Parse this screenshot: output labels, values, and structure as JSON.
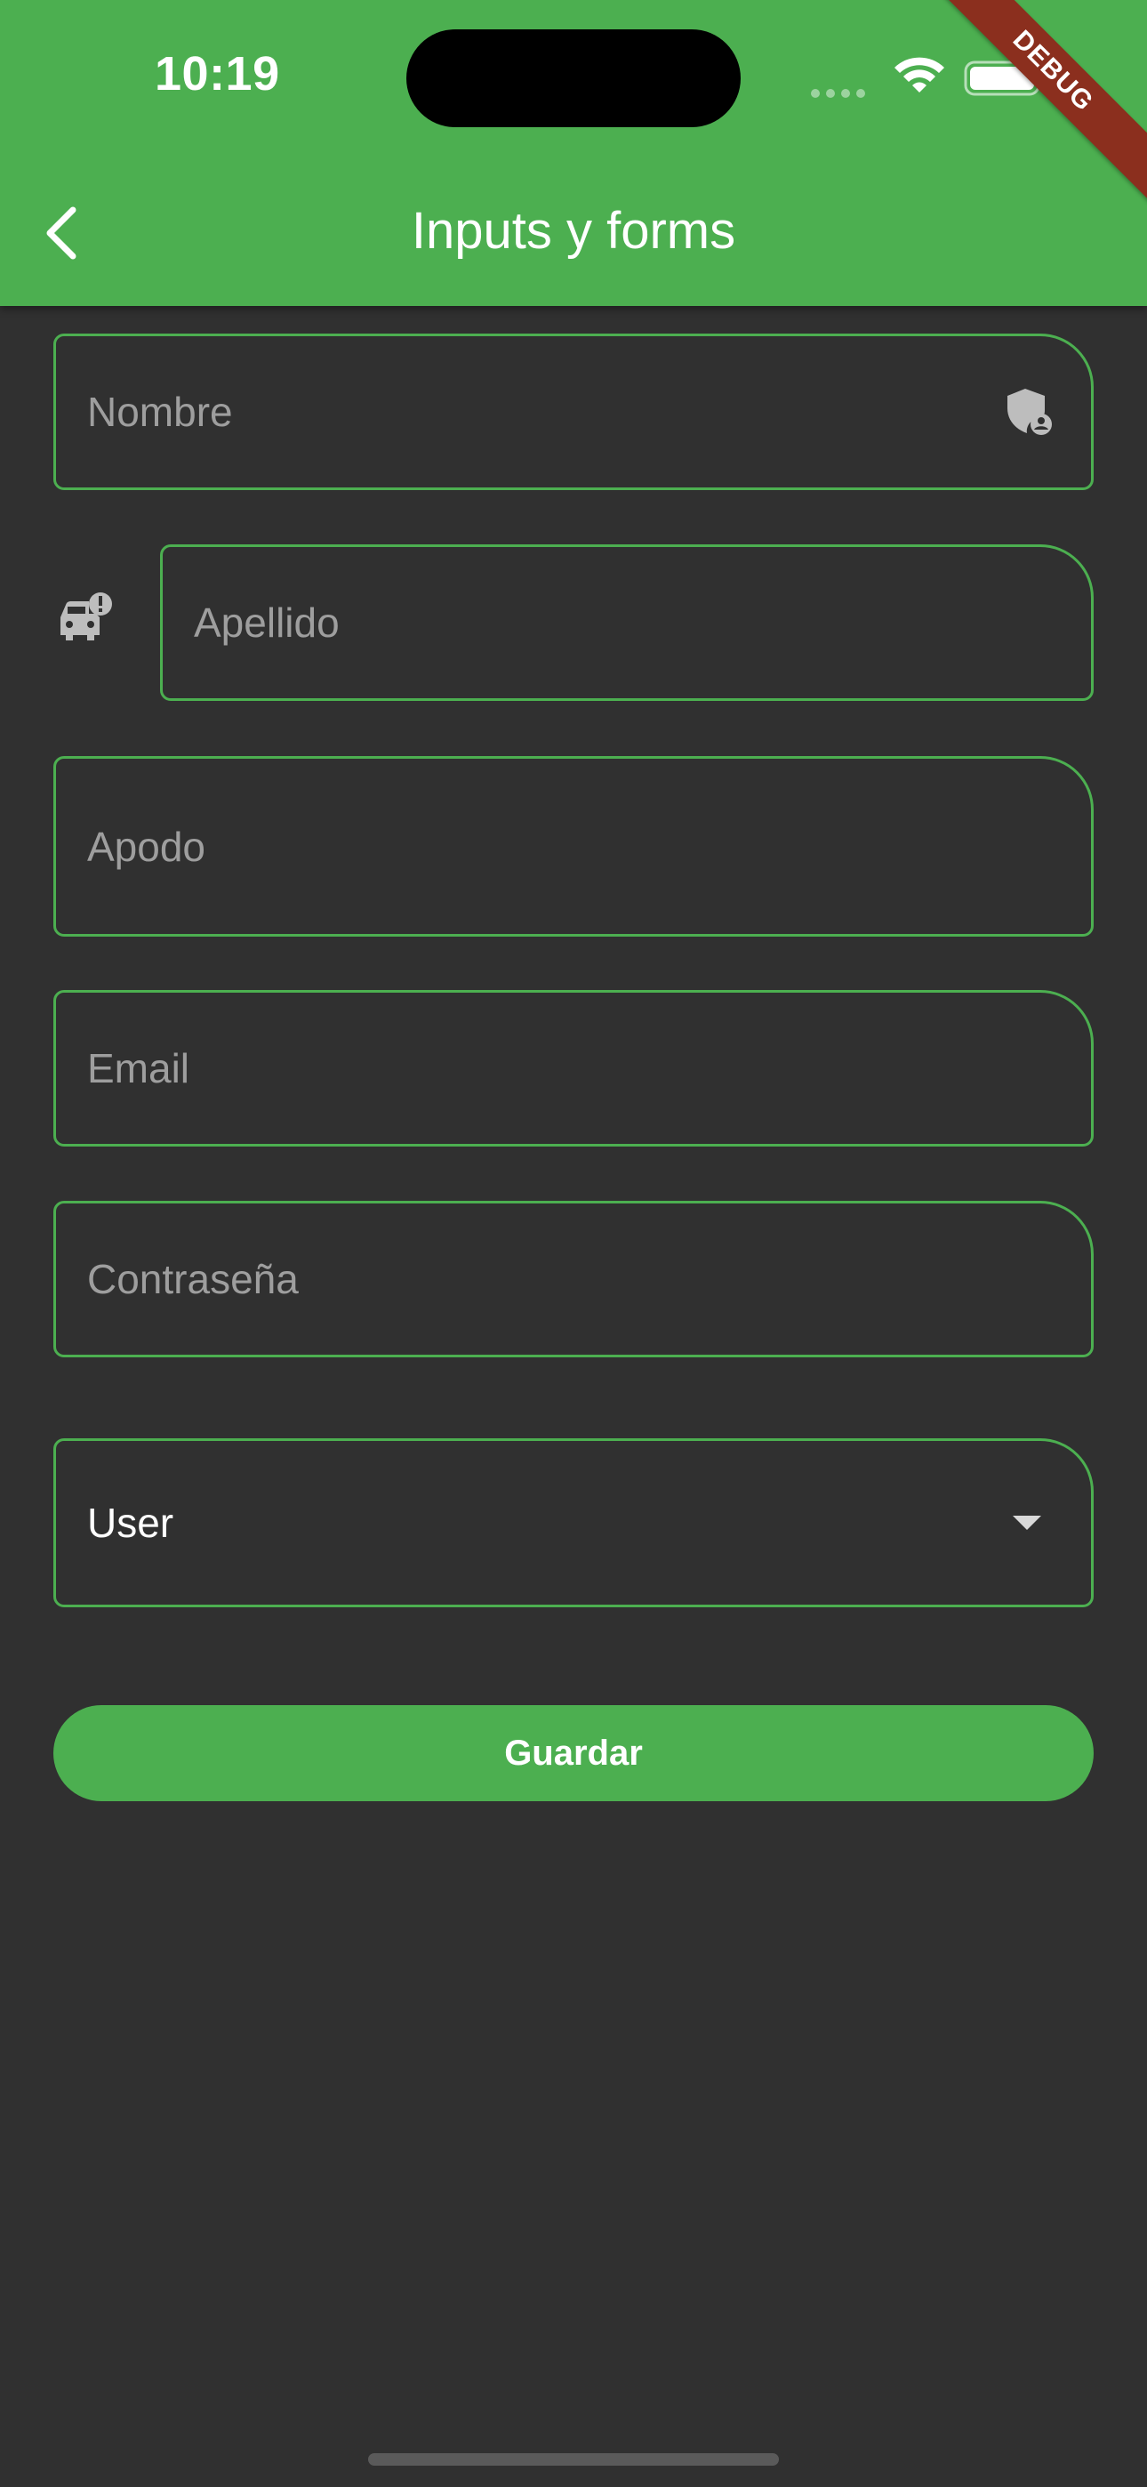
{
  "status_bar": {
    "time": "10:19"
  },
  "debug_banner": "DEBUG",
  "app_bar": {
    "title": "Inputs y forms",
    "back_icon": "chevron-left-icon"
  },
  "form": {
    "nombre": {
      "placeholder": "Nombre",
      "suffix_icon": "shield-user-icon"
    },
    "apellido": {
      "placeholder": "Apellido",
      "prefix_icon": "car-alert-icon"
    },
    "apodo": {
      "placeholder": "Apodo"
    },
    "email": {
      "placeholder": "Email"
    },
    "password": {
      "placeholder": "Contraseña"
    },
    "role": {
      "selected": "User"
    },
    "save_label": "Guardar"
  },
  "colors": {
    "primary": "#4caf50",
    "background": "#303030",
    "hint": "#9e9e9e",
    "debug": "#8b2f1e"
  }
}
